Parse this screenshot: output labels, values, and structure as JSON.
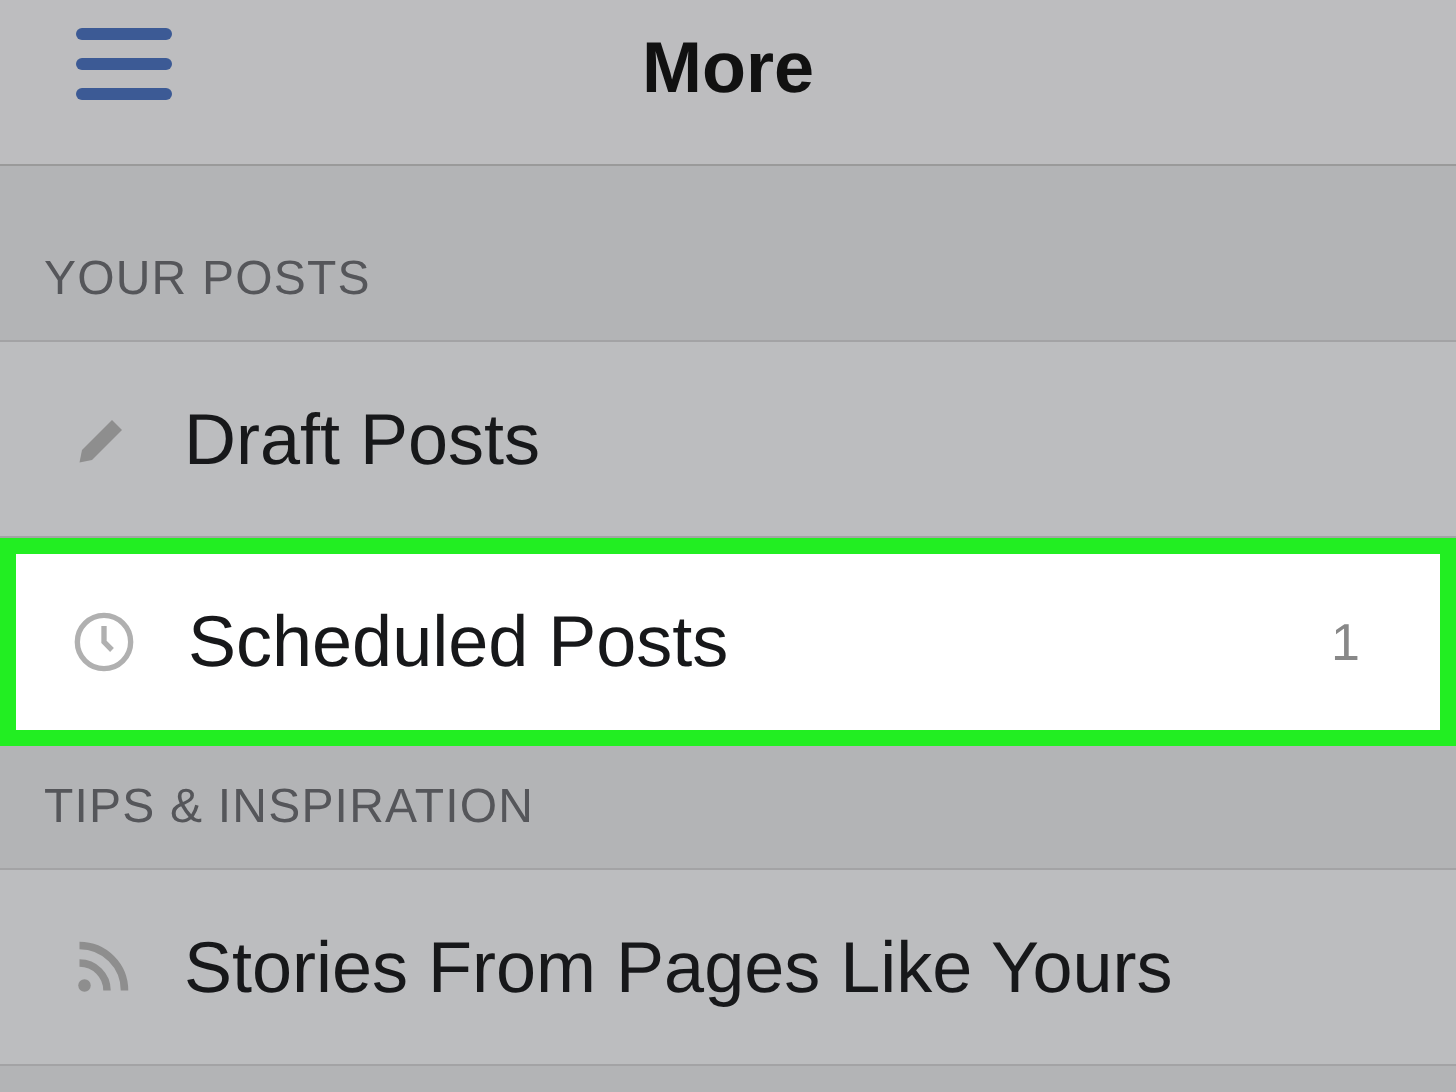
{
  "header": {
    "title": "More"
  },
  "sections": [
    {
      "title": "YOUR POSTS",
      "items": [
        {
          "kind": "draft",
          "label": "Draft Posts",
          "selected": false
        },
        {
          "kind": "scheduled",
          "label": "Scheduled Posts",
          "count": "1",
          "selected": true
        }
      ]
    },
    {
      "title": "TIPS & INSPIRATION",
      "items": [
        {
          "kind": "feed",
          "label": "Stories From Pages Like Yours",
          "selected": false
        }
      ]
    }
  ]
}
